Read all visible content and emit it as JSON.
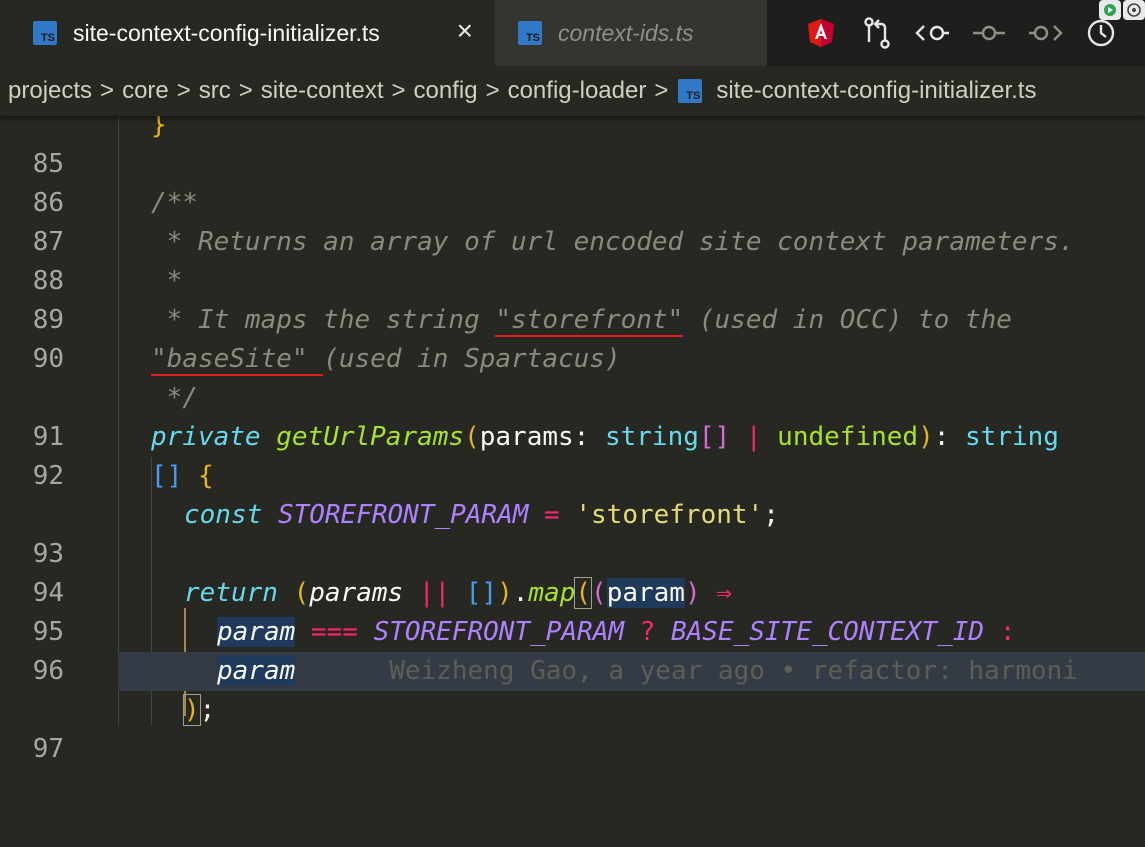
{
  "tabs": [
    {
      "label": "site-context-config-initializer.ts",
      "badge": "TS",
      "close": "×",
      "active": true
    },
    {
      "label": "context-ids.ts",
      "badge": "TS",
      "active": false
    }
  ],
  "toolbar_icons": [
    "angular-icon",
    "source-control-compare-icon",
    "go-back-icon",
    "commit-icon",
    "go-forward-icon",
    "timeline-icon"
  ],
  "breadcrumb": {
    "items": [
      "projects",
      "core",
      "src",
      "site-context",
      "config",
      "config-loader"
    ],
    "file_badge": "TS",
    "file": "site-context-config-initializer.ts"
  },
  "gutter": [
    "85",
    "86",
    "87",
    "88",
    "89",
    "90",
    "91",
    "92",
    "93",
    "94",
    "95",
    "96",
    "97"
  ],
  "code": {
    "l85": "}",
    "l87": "/**",
    "l88": " * Returns an array of url encoded site context parameters.",
    "l89": " *",
    "l90a": " * It maps the string ",
    "l90b": "\"storefront\"",
    "l90c": " (used in OCC) to the",
    "l90d": "\"baseSite\" ",
    "l90e": "(used in Spartacus)",
    "l91": " */",
    "l92_private": "private",
    "l92_name": "getUrlParams",
    "l92_param": "params",
    "l92_type1": "string",
    "l92_undef": "undefined",
    "l92_type2": "string",
    "l93_const": "const",
    "l93_name": "STOREFRONT_PARAM",
    "l93_str": "'storefront'",
    "l95_return": "return",
    "l95_params": "params",
    "l95_map": "map",
    "l95_param": "param",
    "l96_param": "param",
    "l96_op": "===",
    "l96_c1": "STOREFRONT_PARAM",
    "l96_c2": "BASE_SITE_CONTEXT_ID",
    "l96b_param": "param",
    "blame": "Weizheng Gao, a year ago • refactor: harmoni"
  }
}
